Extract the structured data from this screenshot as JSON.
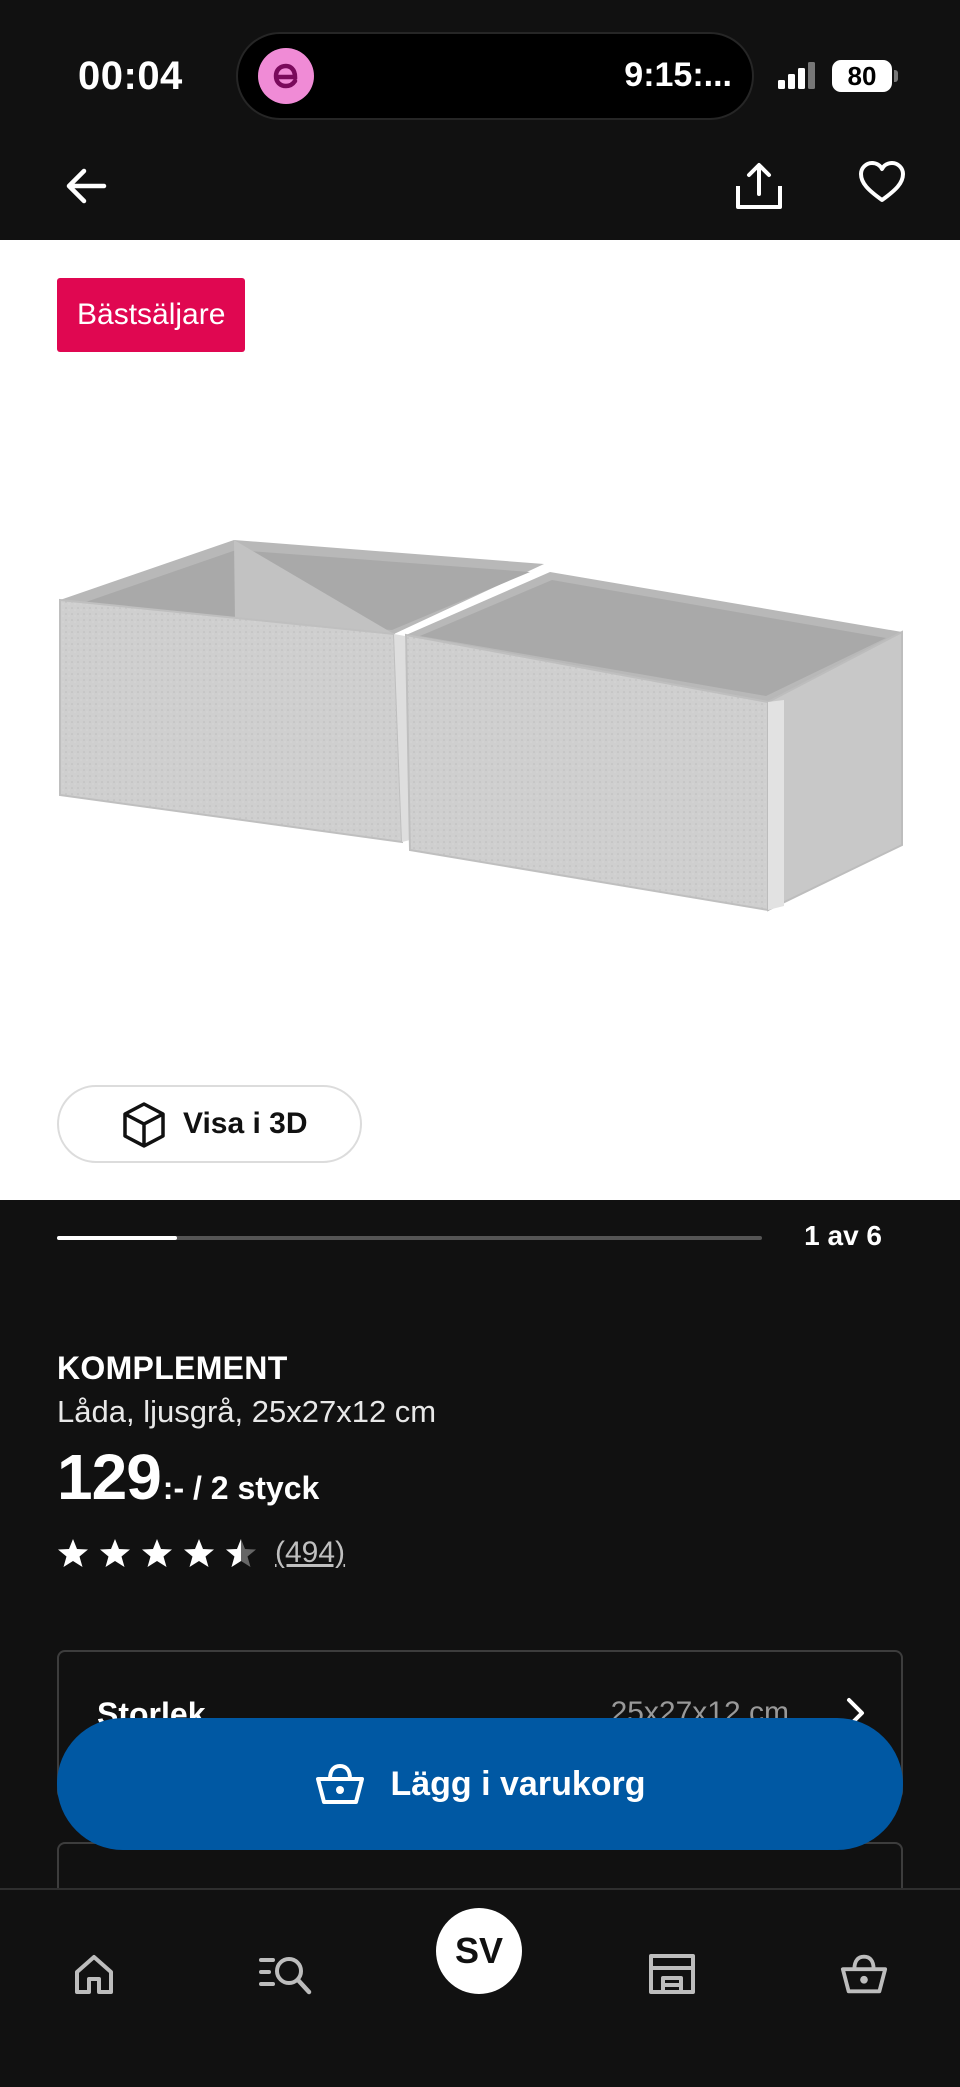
{
  "status_bar": {
    "time": "00:04",
    "island_time": "9:15:...",
    "battery": "80"
  },
  "header": {
    "back_icon": "arrow-left-icon",
    "share_icon": "share-icon",
    "favorite_icon": "heart-icon"
  },
  "gallery": {
    "badge": "Bästsäljare",
    "view_3d_label": "Visa i 3D",
    "counter": "1 av 6",
    "progress": 0.17
  },
  "product": {
    "name": "KOMPLEMENT",
    "description": "Låda, ljusgrå, 25x27x12 cm",
    "price": "129",
    "price_suffix": ":- / 2 styck",
    "rating": 4.5,
    "review_count": "(494)"
  },
  "options": {
    "size_label": "Storlek",
    "size_value": "25x27x12 cm"
  },
  "cart": {
    "label": "Lägg i varukorg"
  },
  "bottom_nav": {
    "home_icon": "home-icon",
    "search_icon": "search-list-icon",
    "avatar": "SV",
    "store_icon": "store-icon",
    "basket_icon": "basket-icon"
  },
  "colors": {
    "background": "#111111",
    "badge": "#e00751",
    "cart_button": "#0058a3",
    "island_app": "#f08bd6"
  }
}
